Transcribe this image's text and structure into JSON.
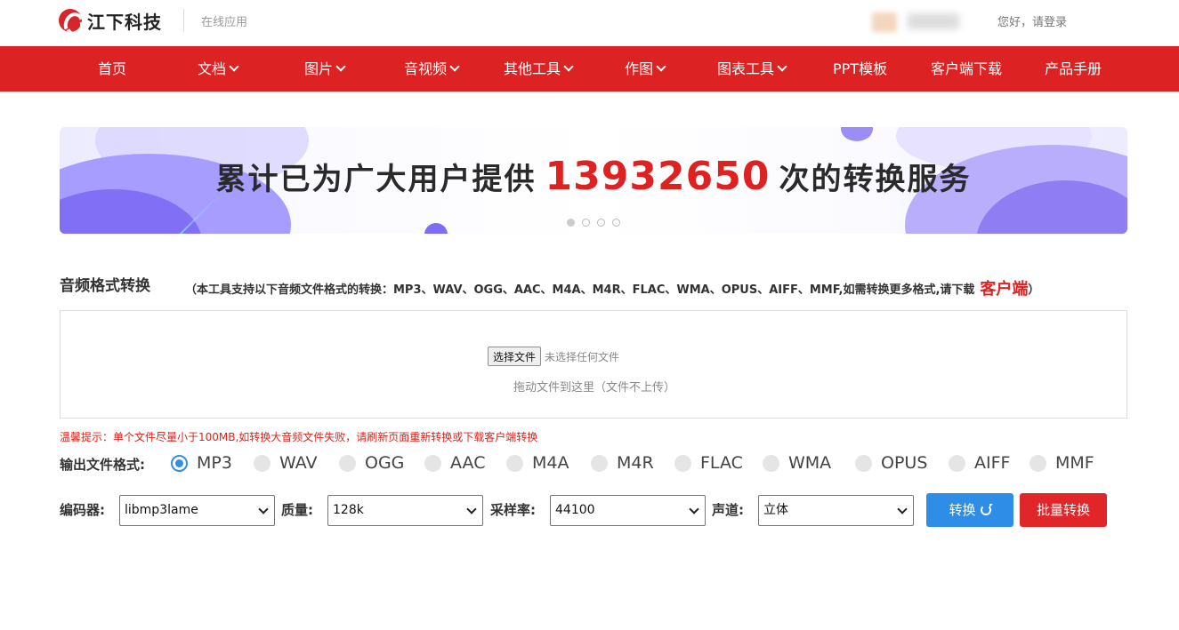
{
  "header": {
    "logo_text": "江下科技",
    "app_subtitle": "在线应用",
    "login": "您好，请登录"
  },
  "nav": {
    "items": [
      {
        "label": "首页",
        "dropdown": false
      },
      {
        "label": "文档",
        "dropdown": true
      },
      {
        "label": "图片",
        "dropdown": true
      },
      {
        "label": "音视频",
        "dropdown": true
      },
      {
        "label": "其他工具",
        "dropdown": true
      },
      {
        "label": "作图",
        "dropdown": true
      },
      {
        "label": "图表工具",
        "dropdown": true
      },
      {
        "label": "PPT模板",
        "dropdown": false
      },
      {
        "label": "客户端下载",
        "dropdown": false
      },
      {
        "label": "产品手册",
        "dropdown": false
      }
    ]
  },
  "banner": {
    "prefix": "累计已为广大用户提供",
    "count": "13932650",
    "suffix": "次的转换服务",
    "slides": 4,
    "active_slide": 1
  },
  "tool": {
    "title": "音频格式转换",
    "desc": "（本工具支持以下音频文件格式的转换：MP3、WAV、OGG、AAC、M4A、M4R、FLAC、WMA、OPUS、AIFF、MMF,如需转换更多格式,请下载",
    "client_link": "客户端",
    "desc_close": "）"
  },
  "upload": {
    "choose_button": "选择文件",
    "file_status": "未选择任何文件",
    "drop_hint": "拖动文件到这里（文件不上传）"
  },
  "tip": "温馨提示：单个文件尽量小于100MB,如转换大音频文件失败，请刷新页面重新转换或下载客户端转换",
  "output": {
    "label": "输出文件格式:",
    "formats": [
      "MP3",
      "WAV",
      "OGG",
      "AAC",
      "M4A",
      "M4R",
      "FLAC",
      "WMA",
      "OPUS",
      "AIFF",
      "MMF"
    ],
    "selected": "MP3"
  },
  "options": {
    "encoder_label": "编码器:",
    "encoder_value": "libmp3lame",
    "quality_label": "质量:",
    "quality_value": "128k",
    "samplerate_label": "采样率:",
    "samplerate_value": "44100",
    "channel_label": "声道:",
    "channel_value": "立体"
  },
  "buttons": {
    "convert": "转换",
    "batch": "批量转换"
  },
  "colors": {
    "brand_red": "#dc2222",
    "primary_blue": "#2e8de6",
    "tip_red": "#d9261c"
  }
}
